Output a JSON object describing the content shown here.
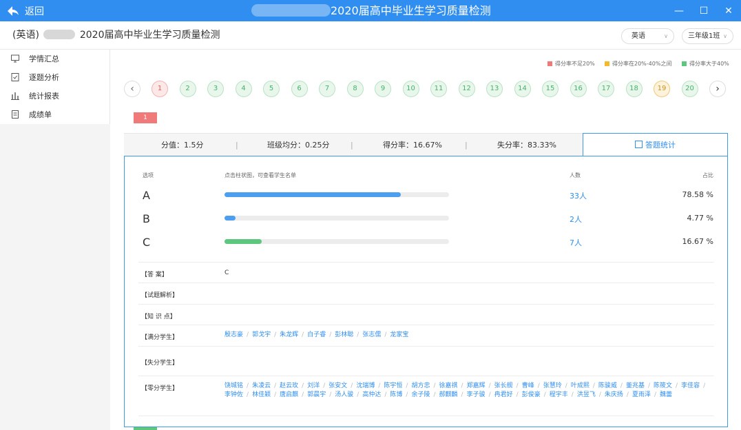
{
  "titlebar": {
    "back": "返回",
    "title": "2020届高中毕业生学习质量检测"
  },
  "header": {
    "crumb_prefix": "(英语)",
    "crumb_title": "2020届高中毕业生学习质量检测",
    "subject": "英语",
    "class": "三年级1班"
  },
  "sidebar": {
    "items": [
      {
        "label": "学情汇总",
        "icon": "monitor-icon"
      },
      {
        "label": "逐题分析",
        "icon": "checklist-icon"
      },
      {
        "label": "统计报表",
        "icon": "bar-chart-icon"
      },
      {
        "label": "成绩单",
        "icon": "document-icon"
      }
    ]
  },
  "legend": [
    {
      "label": "得分率不足20%",
      "color": "#f07a7a"
    },
    {
      "label": "得分率在20%-40%之间",
      "color": "#f5b82e"
    },
    {
      "label": "得分率大于40%",
      "color": "#5dc77d"
    }
  ],
  "questions": [
    {
      "n": "1",
      "s": "r"
    },
    {
      "n": "2",
      "s": "g"
    },
    {
      "n": "3",
      "s": "g"
    },
    {
      "n": "4",
      "s": "g"
    },
    {
      "n": "5",
      "s": "g"
    },
    {
      "n": "6",
      "s": "g"
    },
    {
      "n": "7",
      "s": "g"
    },
    {
      "n": "8",
      "s": "g"
    },
    {
      "n": "9",
      "s": "g"
    },
    {
      "n": "10",
      "s": "g"
    },
    {
      "n": "11",
      "s": "g"
    },
    {
      "n": "12",
      "s": "g"
    },
    {
      "n": "13",
      "s": "g"
    },
    {
      "n": "14",
      "s": "g"
    },
    {
      "n": "15",
      "s": "g"
    },
    {
      "n": "16",
      "s": "g"
    },
    {
      "n": "17",
      "s": "g"
    },
    {
      "n": "18",
      "s": "g"
    },
    {
      "n": "19",
      "s": "y"
    },
    {
      "n": "20",
      "s": "g"
    }
  ],
  "question": {
    "tag": "1",
    "score": "分值：1.5分",
    "avg": "班级均分：0.25分",
    "rate": "得分率：16.67%",
    "loss": "失分率：83.33%",
    "tab": "答题统计"
  },
  "table": {
    "head_option": "选项",
    "head_hint": "点击柱状图，可查看学生名单",
    "head_count": "人数",
    "head_pct": "占比",
    "options": [
      {
        "label": "A",
        "count": "33人",
        "pct": "78.58 %",
        "fraction": 0.7858,
        "color": "#4c9ff0"
      },
      {
        "label": "B",
        "count": "2人",
        "pct": "4.77 %",
        "fraction": 0.0477,
        "color": "#4c9ff0"
      },
      {
        "label": "C",
        "count": "7人",
        "pct": "16.67 %",
        "fraction": 0.1667,
        "color": "#5dc77d"
      }
    ]
  },
  "details": {
    "answer_label": "【答 案】",
    "answer": "C",
    "analysis_label": "【试题解析】",
    "knowledge_label": "【知 识 点】",
    "full_label": "【满分学生】",
    "full_names": [
      "殷志豪",
      "郭戈宇",
      "朱龙辉",
      "白子睿",
      "彭林聪",
      "张志儒",
      "龙家宝"
    ],
    "loss_label": "【失分学生】",
    "zero_label": "【零分学生】",
    "zero_names": [
      "饶城铭",
      "朱凌云",
      "赵云玫",
      "刘洋",
      "张安文",
      "沈瑞博",
      "陈宇恒",
      "胡方忠",
      "徐嘉祺",
      "郑嘉辉",
      "张长舰",
      "曹峰",
      "张慧玲",
      "叶成熙",
      "陈骏威",
      "董兆基",
      "陈筱文",
      "李佳容",
      "李钟佐",
      "林佳颖",
      "唐启麒",
      "郭晨宇",
      "汤人骏",
      "高仲达",
      "陈博",
      "余子陵",
      "郝麒麟",
      "李子骏",
      "冉君好",
      "彭俊豪",
      "程宇丰",
      "洪昱飞",
      "朱庆扬",
      "夏雨泽",
      "魏蕾"
    ]
  }
}
